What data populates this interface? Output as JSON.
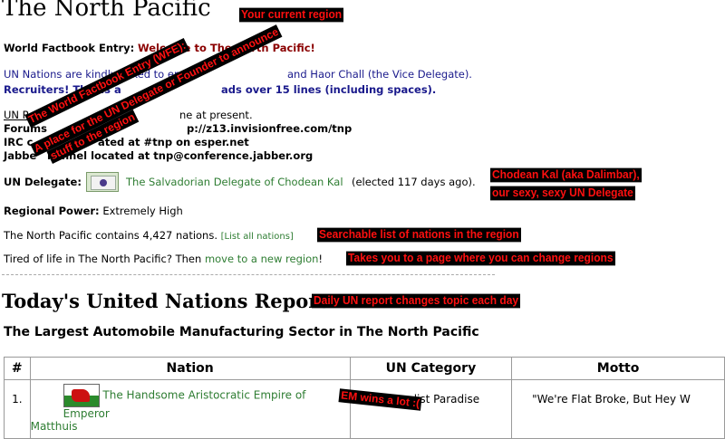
{
  "region": {
    "title": "The North Pacific",
    "wfe_label": "World Factbook Entry:",
    "wfe_value": "Welcome to The North Pacific!",
    "line_un": "UN Nations are kindly asked to end",
    "line_un_tail": "and Haor Chall (the Vice Delegate).",
    "line_recruiters_a": "Recruiters! This is a",
    "line_recruiters_b": "ads over 15 lines (including spaces).",
    "line_un_r": "UN R",
    "line_un_r_tail": "ne at present.",
    "forum_label": "Forums",
    "forum_url": "p://z13.invisionfree.com/tnp",
    "irc_label": "IRC c",
    "irc_tail": "ated at #tnp on esper.net",
    "jabber_label": "Jabbe",
    "jabber_tail": "hannel located at tnp@conference.jabber.org",
    "delegate_label": "UN Delegate:",
    "delegate_name": "The Salvadorian Delegate of Chodean Kal",
    "delegate_elected": "(elected 117 days ago).",
    "power_label": "Regional Power:",
    "power_value": "Extremely High",
    "contains_text": "The North Pacific contains 4,427 nations.",
    "list_all_nations": "[List all nations]",
    "tired_text": "Tired of life in The North Pacific? Then",
    "move_link": "move to a new region",
    "exclaim": "!"
  },
  "report": {
    "heading": "Today's United Nations Report",
    "subheading": "The Largest Automobile Manufacturing Sector in The North Pacific",
    "columns": [
      "#",
      "Nation",
      "UN Category",
      "Motto"
    ],
    "rows": [
      {
        "rank": "1.",
        "nation_a": "The Handsome Aristocratic Empire of Emperor",
        "nation_b": "Matthuis",
        "category": "list Paradise",
        "motto": "\"We're Flat Broke, But Hey W"
      }
    ]
  },
  "annotations": {
    "current_region": "Your current region",
    "wfe_a": "The World Factbook Entry (WFE):",
    "wfe_b": "A place for the UN Delegate or Founder to announce",
    "wfe_c": "stuff to the region",
    "chodean_a": "Chodean Kal (aka Dalimbar),",
    "chodean_b": "our sexy, sexy UN Delegate",
    "searchable": "Searchable list of nations in the region",
    "takes_you": "Takes you to a page where you can change regions",
    "daily": "Daily UN report changes topic each day",
    "em_wins": "EM wins a lot :("
  },
  "colors": {
    "annotation_text": "#ff1010",
    "annotation_bg": "#000000",
    "link_green": "#3a8a2e",
    "navy": "#1a1a8c"
  }
}
